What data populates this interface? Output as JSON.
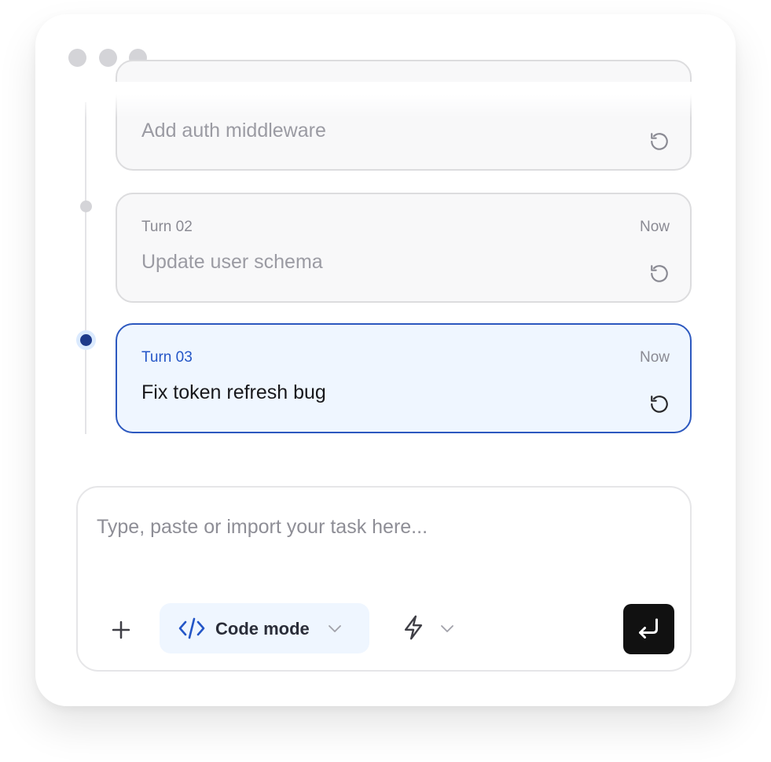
{
  "window": {
    "controls": [
      "dot",
      "dot",
      "dot"
    ]
  },
  "timeline": {
    "turns": [
      {
        "label": "",
        "time": "",
        "title": "Add auth middleware",
        "state": "past"
      },
      {
        "label": "Turn 02",
        "time": "Now",
        "title": "Update user schema",
        "state": "past"
      },
      {
        "label": "Turn 03",
        "time": "Now",
        "title": "Fix token refresh bug",
        "state": "active"
      }
    ],
    "action_icon": "restore-icon"
  },
  "composer": {
    "value": "",
    "placeholder": "Type, paste or import your task here...",
    "add_icon": "plus-icon",
    "mode": {
      "icon": "code-icon",
      "label": "Code mode",
      "dropdown_icon": "chevron-down-icon"
    },
    "speed": {
      "icon": "bolt-icon",
      "dropdown_icon": "chevron-down-icon"
    },
    "submit_icon": "enter-icon"
  },
  "colors": {
    "accent": "#2456c7",
    "active_card_bg": "#eff6ff",
    "active_card_border": "#2c58bf",
    "active_node": "#1e3a8a",
    "submit_bg": "#111111",
    "muted_text": "#8a8a93"
  }
}
